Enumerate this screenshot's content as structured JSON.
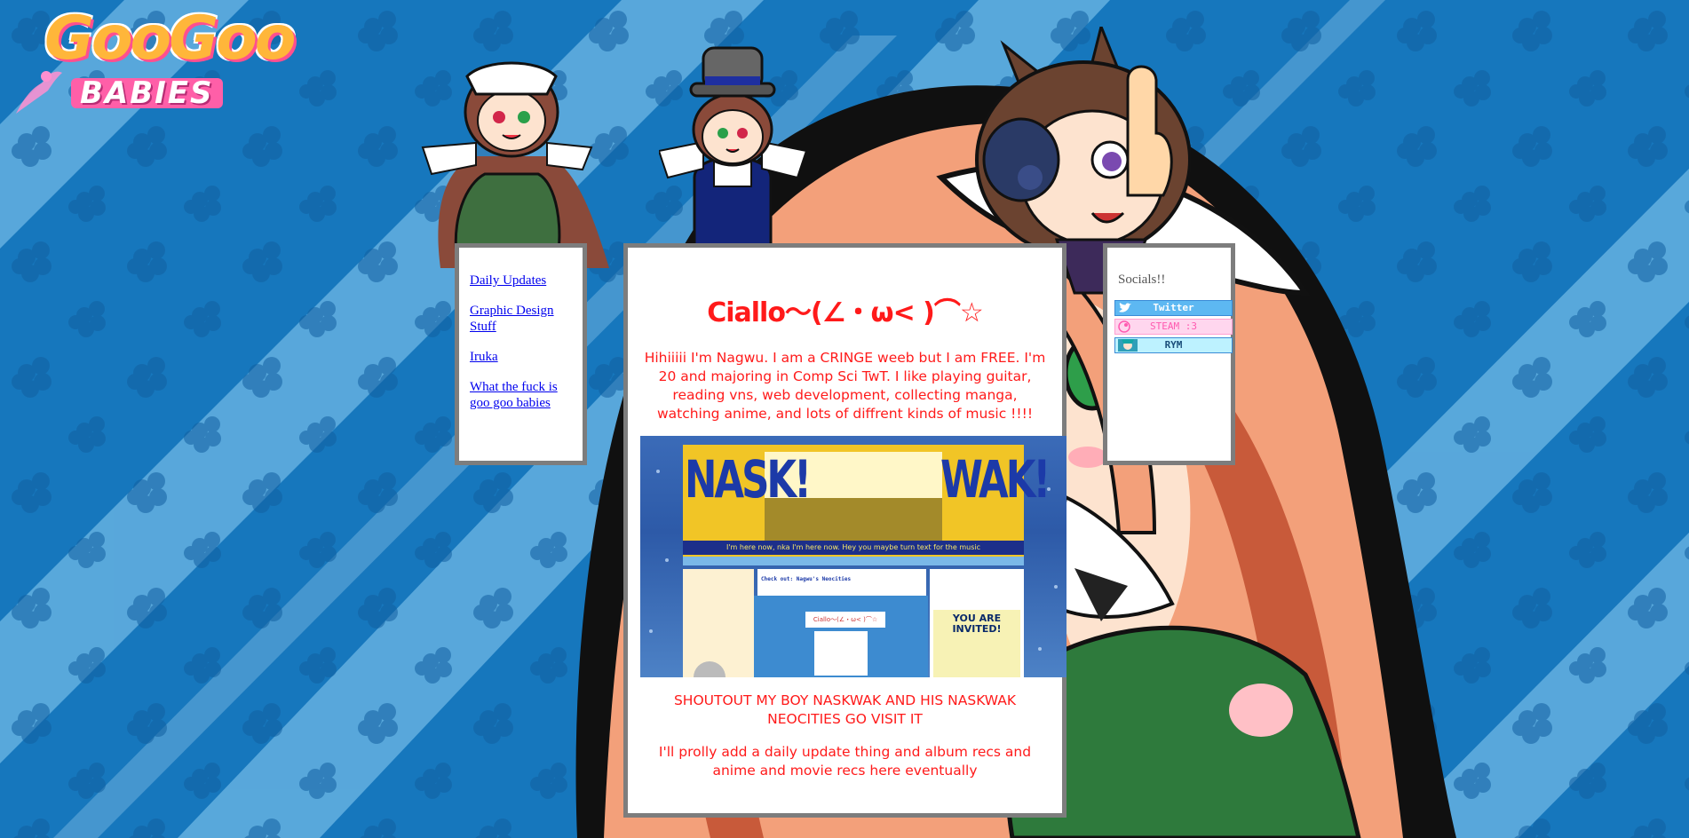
{
  "logo": {
    "line1": "GooGoo",
    "line2": "BABIES"
  },
  "nav": {
    "items": [
      {
        "label": "Daily Updates"
      },
      {
        "label": "Graphic Design Stuff"
      },
      {
        "label": "Iruka"
      },
      {
        "label": "What the fuck is goo goo babies"
      }
    ]
  },
  "main": {
    "title": "Ciallo～(∠・ω< )⌒☆",
    "intro": "Hihiiiii I'm Nagwu. I am a CRINGE weeb but I am FREE. I'm 20 and majoring in Comp Sci TwT. I like playing guitar, reading vns, web development, collecting manga, watching anime, and lots of diffrent kinds of music !!!!",
    "preview": {
      "left_word": "NASK!",
      "right_word": "WAK!",
      "ticker": "I'm here now, nka I'm here now. Hey you maybe turn text for the music",
      "link": "Check out: Nagwu's Neocities",
      "invite": "YOU ARE INVITED!",
      "ciallo_mini": "Ciallo～(∠・ω< )⌒☆"
    },
    "shoutout": "SHOUTOUT MY BOY NASKWAK AND HIS NASKWAK NEOCITIES GO VISIT IT",
    "footnote": "I'll prolly add a daily update thing and album recs and anime and movie recs here eventually"
  },
  "socials": {
    "title": "Socials!!",
    "badges": [
      {
        "label": "Twitter",
        "icon": "twitter-bird-icon"
      },
      {
        "label": "STEAM :3",
        "icon": "steam-icon"
      },
      {
        "label": "RYM",
        "icon": "anime-girl-icon"
      }
    ]
  },
  "colors": {
    "background": "#1a86c8",
    "text_red": "#ff1a1a",
    "link_blue": "#0000ee",
    "panel_border": "#7d7d7d"
  }
}
